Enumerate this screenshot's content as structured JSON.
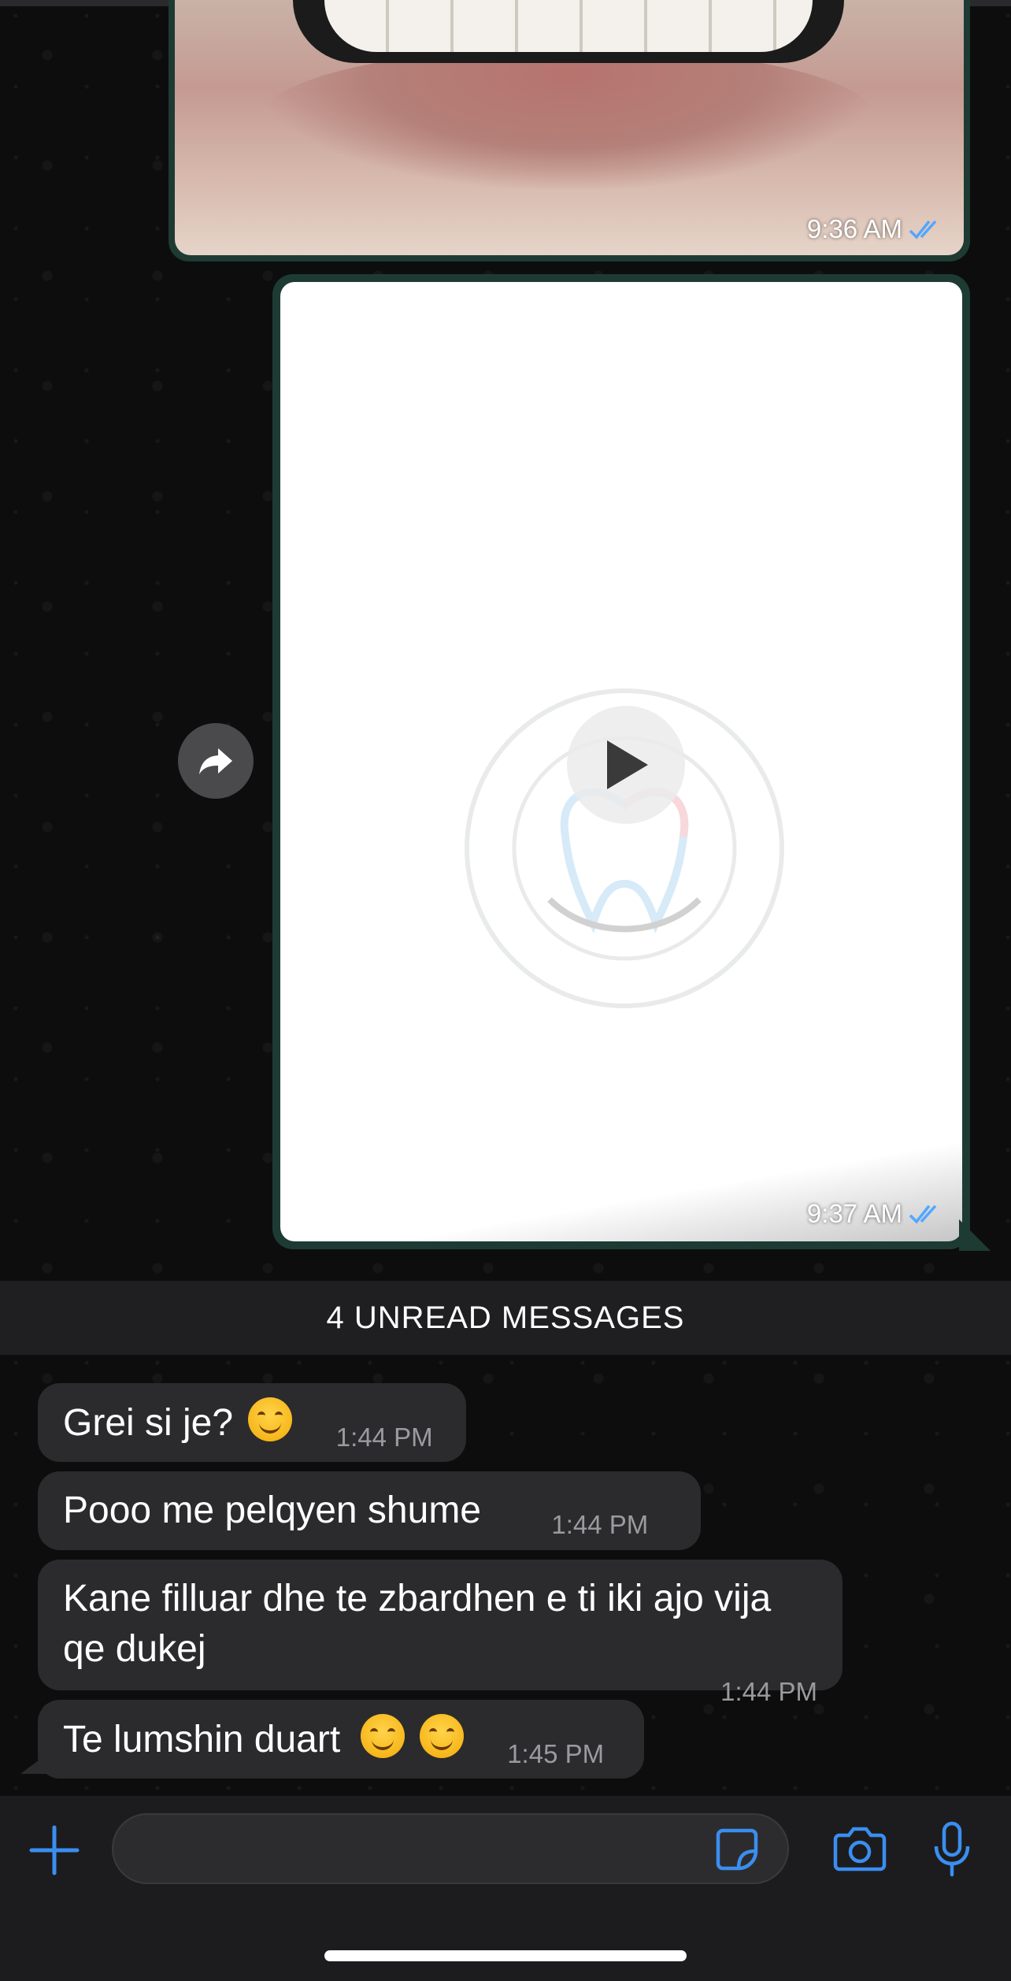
{
  "chat": {
    "image_message": {
      "time": "9:36 AM",
      "status": "read"
    },
    "video_message": {
      "time": "9:37 AM",
      "status": "read"
    },
    "unread_banner": "4 UNREAD MESSAGES",
    "messages": [
      {
        "text": "Grei si je?",
        "emoji": "smiling-face-with-smiling-eyes",
        "time": "1:44 PM"
      },
      {
        "text": "Pooo me pelqyen shume",
        "time": "1:44 PM"
      },
      {
        "text": "Kane filluar dhe te zbardhen e ti iki ajo vija qe dukej",
        "time": "1:44 PM"
      },
      {
        "text": "Te lumshin duart",
        "emoji": "smiling-face-with-smiling-eyes x2",
        "time": "1:45 PM"
      }
    ]
  },
  "composer": {
    "icons": [
      "plus-icon",
      "sticker-icon",
      "camera-icon",
      "microphone-icon"
    ],
    "accent": "#3b8ef0"
  },
  "colors": {
    "outgoing_bubble": "#1d3b33",
    "incoming_bubble": "#2b2b2d",
    "read_ticks": "#53a6ff"
  }
}
